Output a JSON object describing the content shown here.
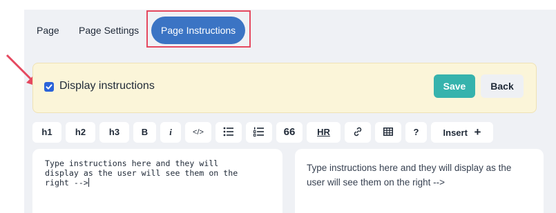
{
  "tabs": [
    {
      "label": "Page"
    },
    {
      "label": "Page Settings"
    },
    {
      "label": "Page Instructions",
      "active": true
    }
  ],
  "banner": {
    "checkbox_checked": true,
    "label": "Display instructions",
    "save_label": "Save",
    "back_label": "Back"
  },
  "toolbar": {
    "items": [
      "h1",
      "h2",
      "h3",
      "B",
      "i",
      "</>",
      "bulleted-list-icon",
      "numbered-list-icon",
      "66",
      "HR",
      "link-icon",
      "table-icon",
      "?",
      "Insert"
    ],
    "insert_label": "Insert"
  },
  "editor": {
    "text": "Type instructions here and they will\ndisplay as the user will see them on the\nright -->"
  },
  "preview": {
    "text": "Type instructions here and they will display as the user will see them on the right -->"
  },
  "colors": {
    "active_tab": "#3b74c4",
    "save_button": "#36b3ad",
    "banner_bg": "#fbf5d9",
    "highlight": "#e5485f"
  }
}
